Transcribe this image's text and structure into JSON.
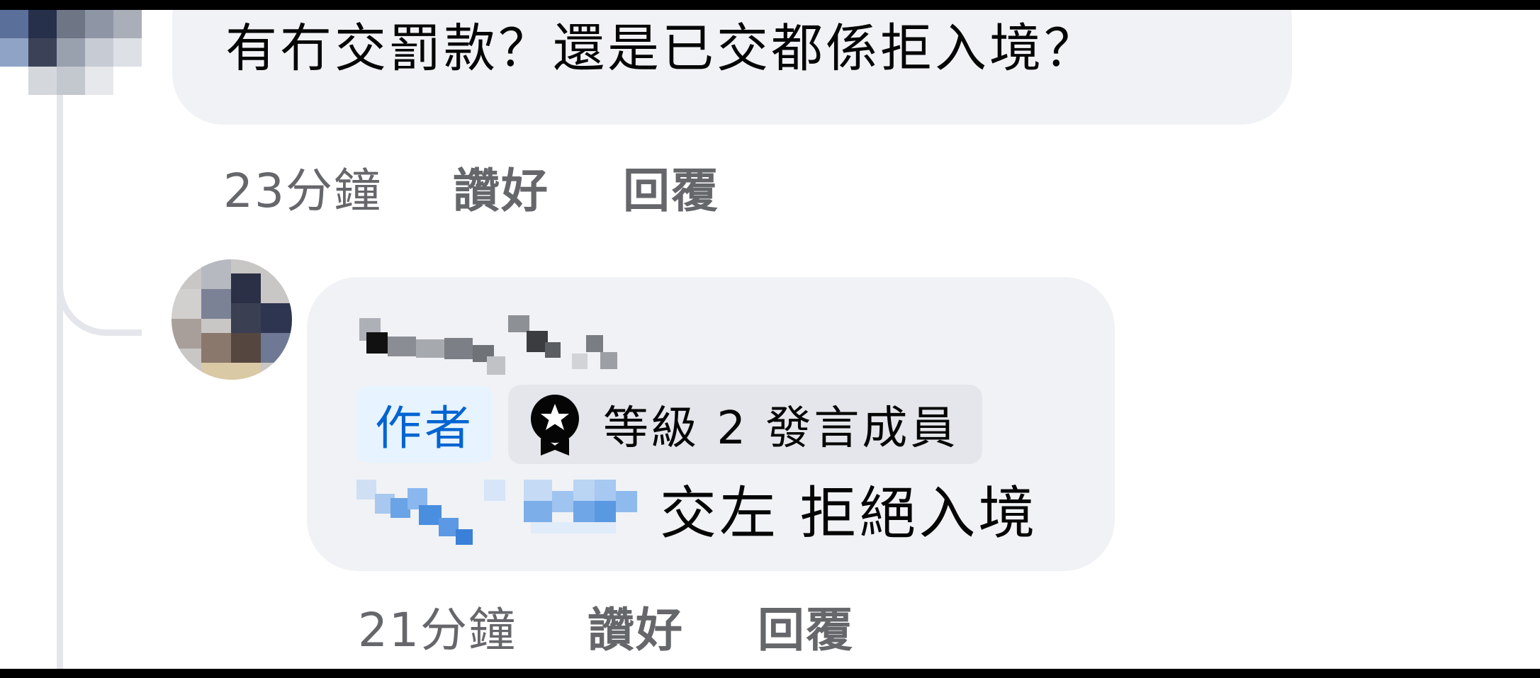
{
  "comment": {
    "text": "有冇交罰款？還是已交都係拒入境？",
    "time": "23分鐘",
    "like_label": "讚好",
    "reply_label": "回覆"
  },
  "reply": {
    "author_badge": "作者",
    "level_badge": "等級 2 發言成員",
    "text": "交左 拒絕入境",
    "time": "21分鐘",
    "like_label": "讚好",
    "reply_label": "回覆"
  },
  "colors": {
    "bubble": "#f0f2f5",
    "author_badge_text": "#0064d1",
    "author_badge_bg": "#e7f3ff",
    "meta_text": "#65676b",
    "mention_blur": "#6aa8e8"
  }
}
